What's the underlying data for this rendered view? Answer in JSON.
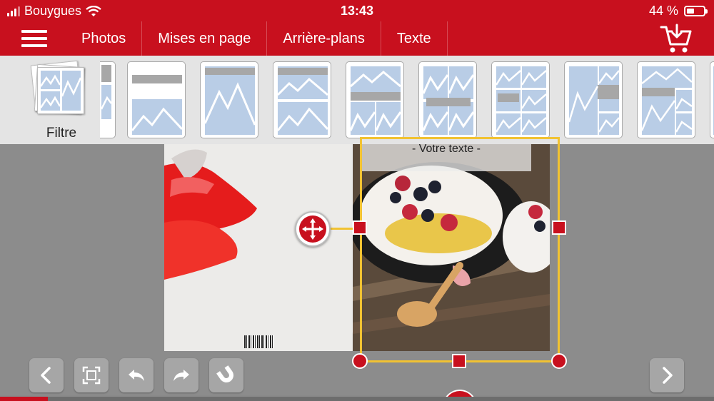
{
  "status": {
    "carrier": "Bouygues",
    "time": "13:43",
    "battery_text": "44 %",
    "battery_level": 0.44
  },
  "nav": {
    "tabs": [
      "Photos",
      "Mises en page",
      "Arrière-plans",
      "Texte"
    ],
    "menu_icon": "hamburger-menu-icon",
    "cart_icon": "cart-download-icon"
  },
  "layouts": {
    "filter_label": "Filtre"
  },
  "canvas": {
    "text_placeholder": "- Votre texte -"
  },
  "toolbar": {
    "icons": [
      "prev-arrow-icon",
      "fit-frame-icon",
      "undo-icon",
      "redo-icon",
      "magnet-icon",
      "next-arrow-icon"
    ]
  },
  "progress": 0.067,
  "colors": {
    "brand_red": "#c8101e",
    "selection_yellow": "#f1c232",
    "layout_blue": "#b9cde6",
    "canvas_gray": "#8c8c8c"
  }
}
